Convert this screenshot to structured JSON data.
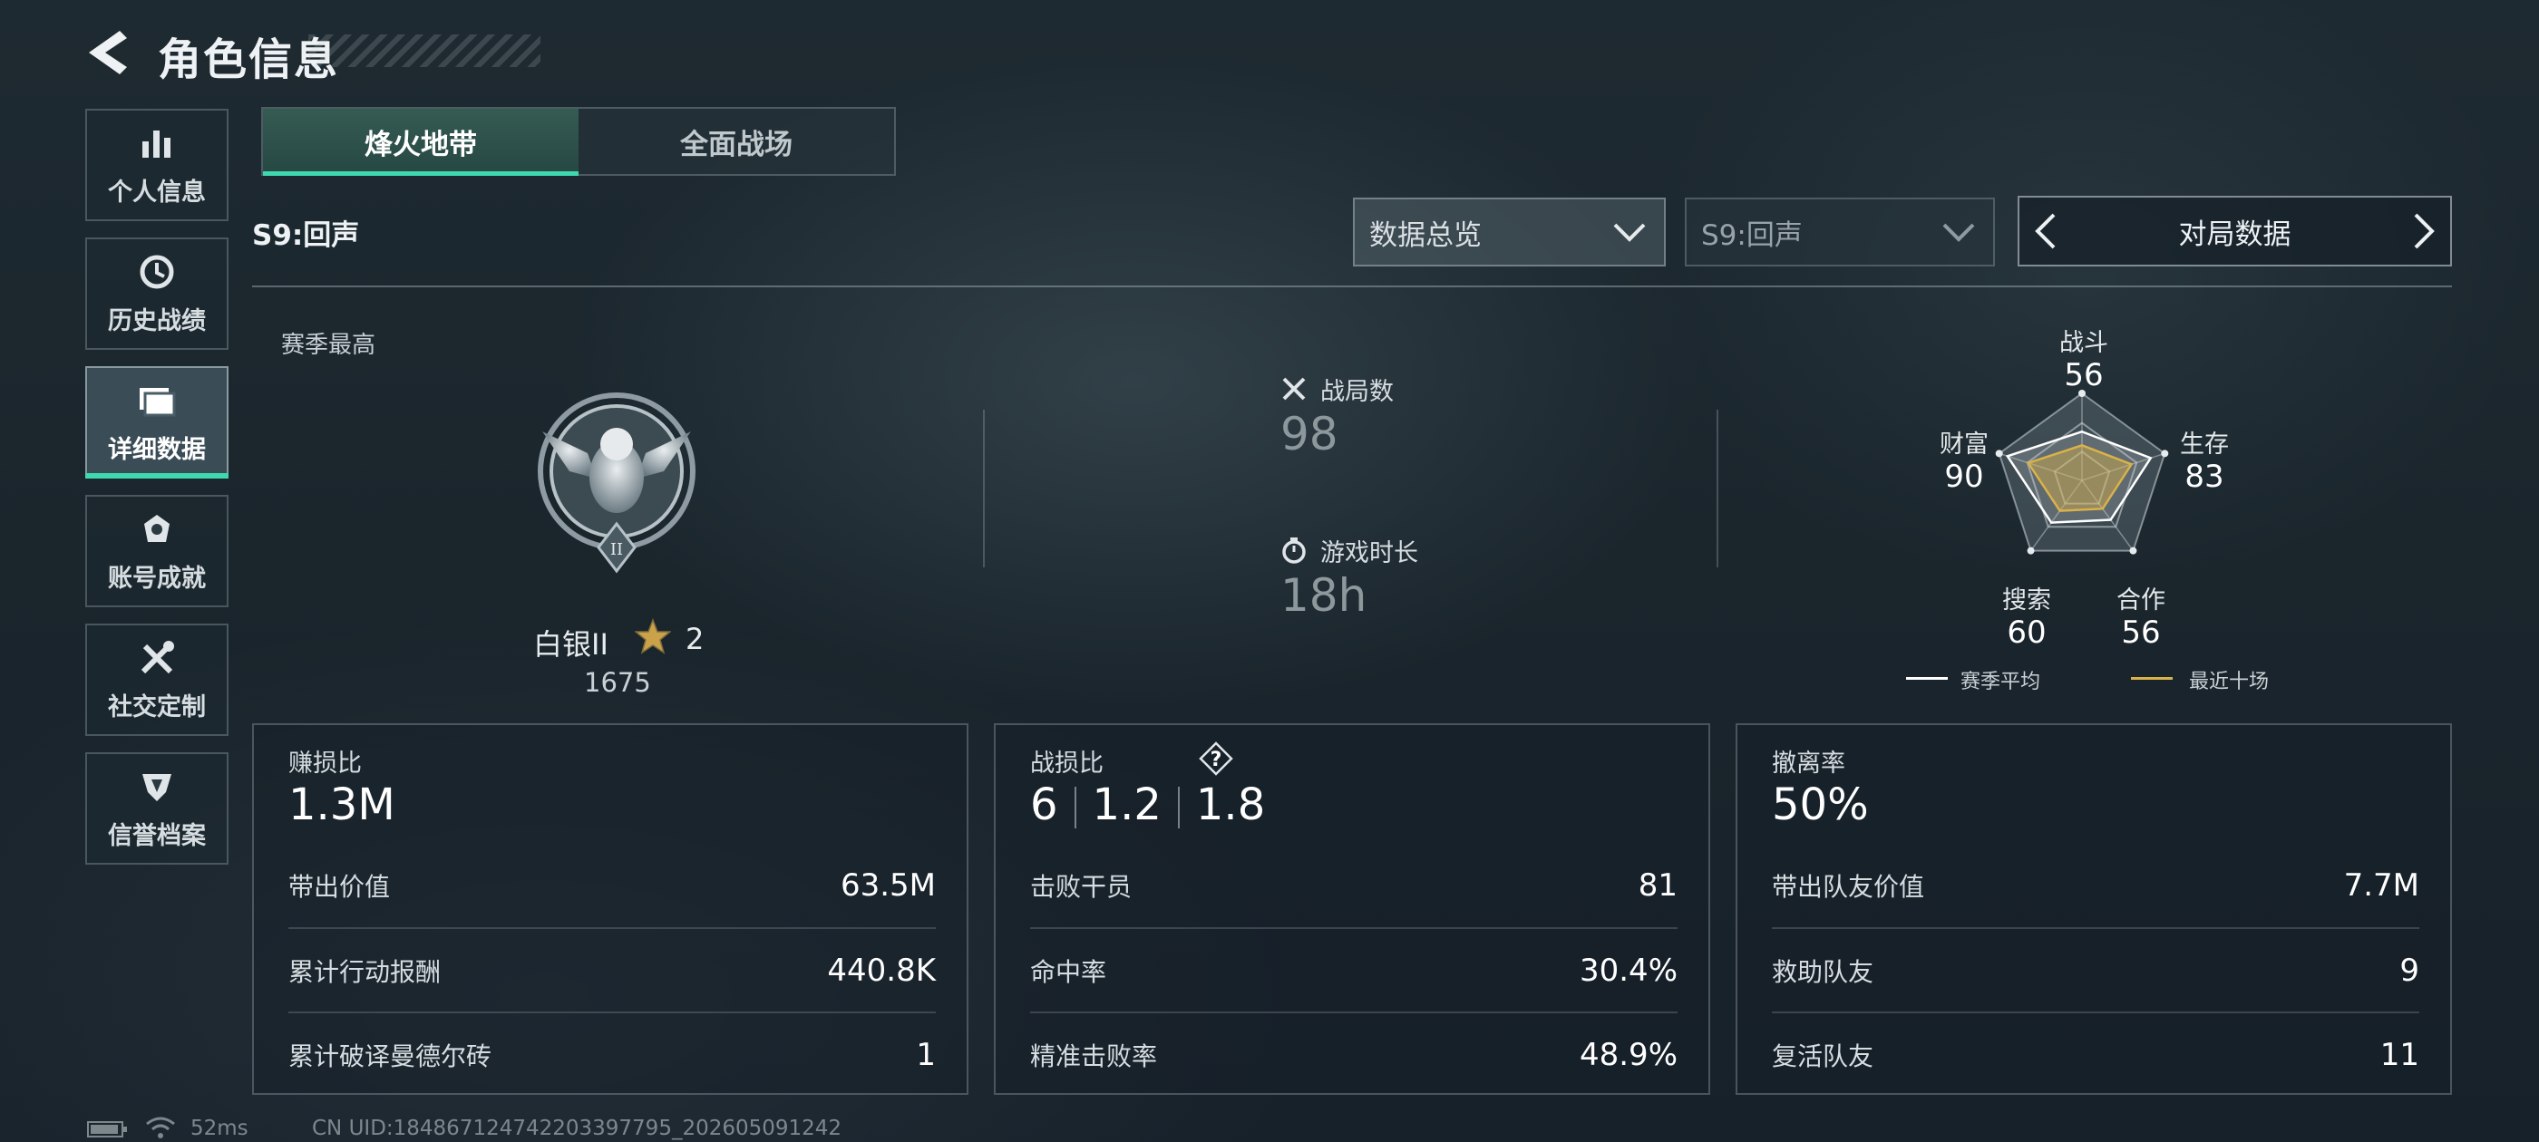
{
  "header": {
    "title": "角色信息"
  },
  "sidebar": {
    "items": [
      {
        "label": "个人信息",
        "icon": "bar-chart-icon"
      },
      {
        "label": "历史战绩",
        "icon": "history-clock-icon"
      },
      {
        "label": "详细数据",
        "icon": "folder-icon",
        "active": true
      },
      {
        "label": "账号成就",
        "icon": "achievement-icon"
      },
      {
        "label": "社交定制",
        "icon": "tools-icon"
      },
      {
        "label": "信誉档案",
        "icon": "shield-icon"
      }
    ]
  },
  "tabs": [
    {
      "label": "烽火地带",
      "active": true
    },
    {
      "label": "全面战场",
      "active": false
    }
  ],
  "season_label": "S9:回声",
  "filters": {
    "view": "数据总览",
    "season": "S9:回声",
    "data_type": "对局数据"
  },
  "rank": {
    "section_label": "赛季最高",
    "name": "白银II",
    "stars": "2",
    "score": "1675"
  },
  "summary": {
    "games_label": "战局数",
    "games_value": "98",
    "time_label": "游戏时长",
    "time_value": "18h"
  },
  "radar": {
    "axes": [
      {
        "label": "战斗",
        "value": "56"
      },
      {
        "label": "生存",
        "value": "83"
      },
      {
        "label": "合作",
        "value": "56"
      },
      {
        "label": "搜索",
        "value": "60"
      },
      {
        "label": "财富",
        "value": "90"
      }
    ],
    "legend": [
      {
        "label": "赛季平均",
        "color": "#ffffff"
      },
      {
        "label": "最近十场",
        "color": "#d9b24a"
      }
    ]
  },
  "cards": [
    {
      "title": "赚损比",
      "main": "1.3M",
      "rows": [
        {
          "label": "带出价值",
          "value": "63.5M"
        },
        {
          "label": "累计行动报酬",
          "value": "440.8K"
        },
        {
          "label": "累计破译曼德尔砖",
          "value": "1"
        }
      ]
    },
    {
      "title": "战损比",
      "main_parts": [
        "6",
        "1.2",
        "1.8"
      ],
      "rows": [
        {
          "label": "击败干员",
          "value": "81"
        },
        {
          "label": "命中率",
          "value": "30.4%"
        },
        {
          "label": "精准击败率",
          "value": "48.9%"
        }
      ]
    },
    {
      "title": "撤离率",
      "main": "50%",
      "rows": [
        {
          "label": "带出队友价值",
          "value": "7.7M"
        },
        {
          "label": "救助队友",
          "value": "9"
        },
        {
          "label": "复活队友",
          "value": "11"
        }
      ]
    }
  ],
  "footer": {
    "ping": "52ms",
    "uid": "CN UID:184867124742203397795_202605091242"
  },
  "colors": {
    "accent": "#3fd9b0",
    "gold": "#d9b24a"
  }
}
